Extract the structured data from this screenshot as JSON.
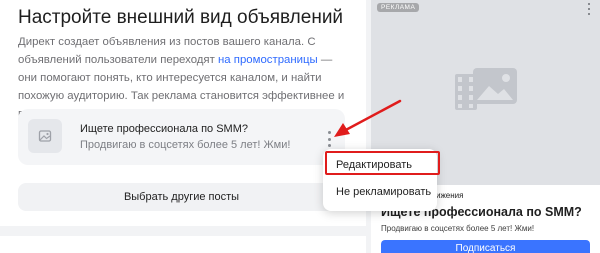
{
  "settings": {
    "title": "Настройте внешний вид объявлений",
    "desc_part1": "Директ создает объявления из постов вашего канала. С объявлений пользователи переходят ",
    "desc_link": "на промостраницы",
    "desc_part2": " — они помогают понять, кто интересуется каналом, и найти похожую аудиторию. Так реклама становится эффективнее и выгоднее"
  },
  "ad_card": {
    "title": "Ищете профессионала по SMM?",
    "subtitle": "Продвигаю в соцсетях более 5 лет! Жми!"
  },
  "choose_button_label": "Выбрать другие посты",
  "context_menu": {
    "items": [
      "Редактировать",
      "Не рекламировать"
    ],
    "highlighted_item": "Редактировать"
  },
  "preview": {
    "badge": "РЕКЛАМА",
    "promo_label": "продвижения",
    "title": "Ищете профессионала по SMM?",
    "subtitle": "Продвигаю в соцсетях более 5 лет! Жми!",
    "subscribe_label": "Подписаться"
  },
  "colors": {
    "accent": "#2f6bff",
    "button_blue": "#3a74ff",
    "annotation_red": "#e01c1c"
  }
}
